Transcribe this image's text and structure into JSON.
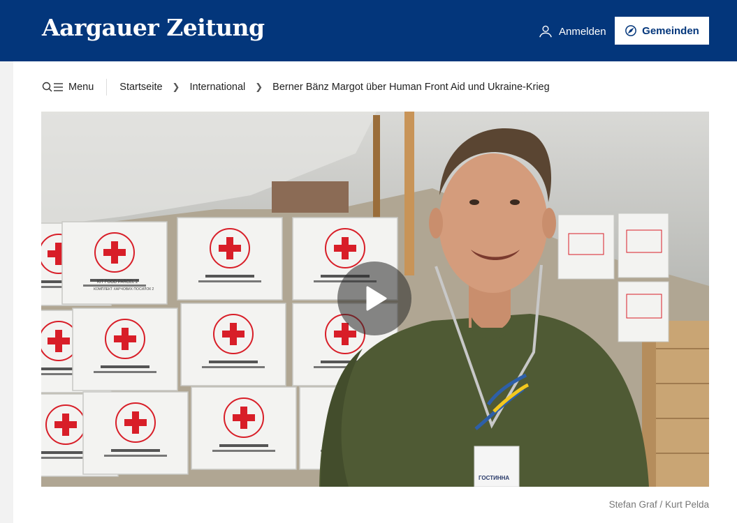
{
  "header": {
    "logo": "Aargauer Zeitung",
    "login_label": "Anmelden",
    "gemeinden_label": "Gemeinden"
  },
  "breadcrumb": {
    "menu_label": "Menu",
    "items": [
      "Startseite",
      "International",
      "Berner Bänz Margot über Human Front Aid und Ukraine-Krieg"
    ]
  },
  "media": {
    "box_text_1": "KIT FOOD PARCEL 2",
    "box_text_2": "КОМПЛЕКТ ХАРЧОВИХ ПОСИЛОК 2",
    "badge_text": "ГОСТИННА",
    "credit": "Stefan Graf / Kurt Pelda"
  },
  "colors": {
    "brand_blue": "#03367b",
    "red_cross": "#d81e28"
  }
}
